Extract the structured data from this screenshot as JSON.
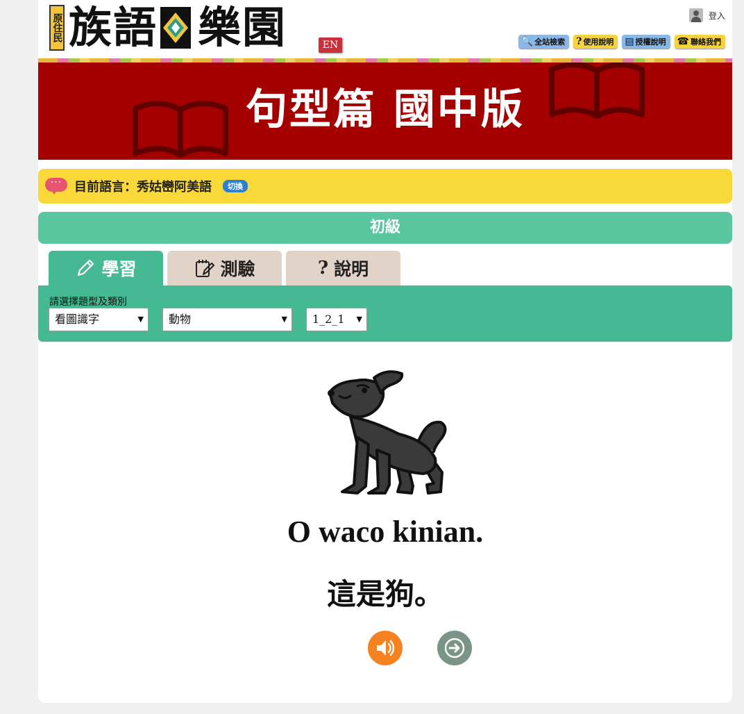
{
  "header": {
    "logo_side": "原住民",
    "logo_text_1": "族語",
    "logo_text_2": "樂園",
    "en_label": "EN",
    "login_label": "登入",
    "nav": [
      {
        "label": "全站檢索",
        "icon": "magnifier-icon",
        "color": "#8ab8e6"
      },
      {
        "label": "使用說明",
        "icon": "question-icon",
        "color": "#f5d340"
      },
      {
        "label": "授權說明",
        "icon": "document-icon",
        "color": "#8ab8e6"
      },
      {
        "label": "聯絡我們",
        "icon": "phone-icon",
        "color": "#f5d340"
      }
    ]
  },
  "banner": {
    "title": "句型篇 國中版",
    "color": "#a40000"
  },
  "language": {
    "label": "目前語言：秀姑巒阿美語",
    "switch_label": "切換"
  },
  "level": {
    "label": "初級"
  },
  "tabs": [
    {
      "label": "學習",
      "icon": "pencil-icon",
      "active": true
    },
    {
      "label": "測驗",
      "icon": "notepad-icon",
      "active": false
    },
    {
      "label": "說明",
      "icon": "question-icon",
      "active": false
    }
  ],
  "filter": {
    "label": "請選擇題型及類別",
    "type_value": "看圖識字",
    "category_value": "動物",
    "item_value": "1_2_1"
  },
  "content": {
    "image_icon": "dog-icon",
    "sentence": "O waco kinian.",
    "translation": "這是狗。"
  },
  "colors": {
    "green_tab": "#45b994",
    "level_bar": "#5ac6a0",
    "language_bar": "#f9d93a",
    "audio_button": "#f58220",
    "next_button": "#7a9488"
  }
}
